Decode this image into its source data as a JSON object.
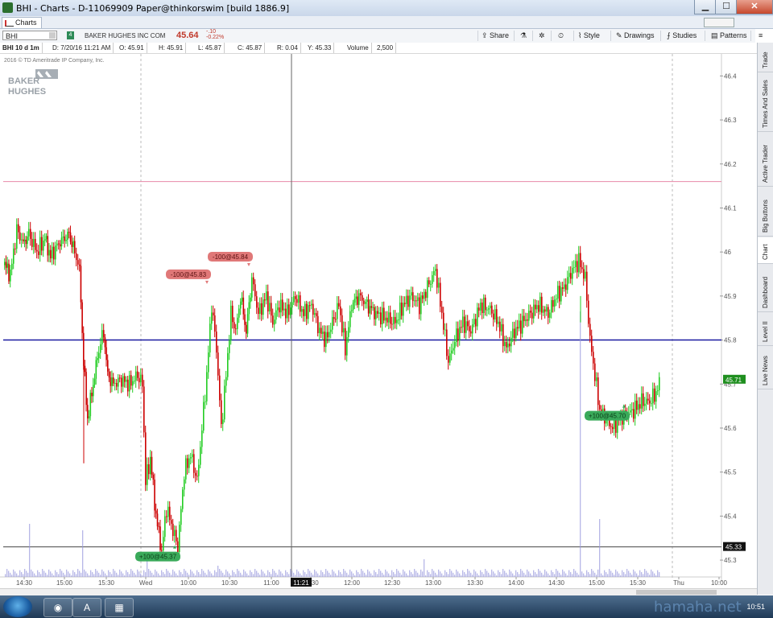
{
  "window": {
    "title": "BHI - Charts - D-11069909 Paper@thinkorswim [build 1886.9]",
    "tab_label": "Charts",
    "controls": {
      "minimize": "▁",
      "maximize": "☐",
      "close": "✕"
    }
  },
  "toolbar": {
    "symbol": "BHI",
    "company": "BAKER HUGHES INC COM",
    "last_price": "45.64",
    "change": "-.10",
    "change_pct": "-0.22%",
    "buttons": {
      "share": "Share",
      "style": "Style",
      "drawings": "Drawings",
      "studies": "Studies",
      "patterns": "Patterns"
    }
  },
  "infobar": {
    "symbol_period": "BHI 10 d 1m",
    "date": "D: 7/20/16 11:21 AM",
    "open": "O: 45.91",
    "high": "H: 45.91",
    "low": "L: 45.87",
    "close": "C: 45.87",
    "range": "R: 0.04",
    "y": "Y: 45.33",
    "volume_label": "Volume",
    "volume": "2,500"
  },
  "copyright": "2016 © TD Ameritrade IP Company, Inc.",
  "logo": {
    "line1": "BAKER",
    "line2": "HUGHES"
  },
  "sidebar_tabs": [
    "Trade",
    "Times And Sales",
    "Active Trader",
    "Big Buttons",
    "Chart",
    "Dashboard",
    "Level II",
    "Live News"
  ],
  "sidebar_active": "Chart",
  "colors": {
    "up": "#22cc22",
    "down": "#cc0000",
    "pink_line": "#e88aa8",
    "blue_line": "#1a1aa0",
    "volume": "#9999dd",
    "price_tag": "#1f8f1f",
    "sell_bubble": "#e07878",
    "buy_bubble": "#3aaa5a"
  },
  "taskbar": {
    "time": "10:51"
  },
  "watermark": "hamaha.net",
  "chart_data": {
    "type": "candlestick",
    "y_ticks": [
      "46.4",
      "46.3",
      "46.2",
      "46.1",
      "46",
      "45.9",
      "45.8",
      "45.7",
      "45.6",
      "45.5",
      "45.4",
      "45.3"
    ],
    "ylim": [
      45.28,
      46.45
    ],
    "x_ticks": [
      "14:30",
      "15:00",
      "15:30",
      "Wed",
      "10:00",
      "10:30",
      "11:00",
      "11:30",
      "12:00",
      "12:30",
      "13:00",
      "13:30",
      "14:00",
      "14:30",
      "15:00",
      "15:30",
      "Thu",
      "10:00"
    ],
    "crosshair_time": "11:21",
    "current_price_tag": "45.71",
    "crosshair_price_tag": "45.33",
    "horizontal_lines": [
      {
        "price": 46.16,
        "color": "pink"
      },
      {
        "price": 45.8,
        "color": "blue"
      },
      {
        "price": 45.33,
        "color": "gray"
      }
    ],
    "trades": [
      {
        "label": "-100@45.83",
        "side": "sell",
        "x_index": 260,
        "price": 45.92
      },
      {
        "label": "-100@45.84",
        "side": "sell",
        "x_index": 312,
        "price": 45.96
      },
      {
        "label": "+100@45.37",
        "side": "buy",
        "x_index": 220,
        "price": 45.33
      },
      {
        "label": "+100@45.70",
        "side": "buy",
        "x_index": 778,
        "price": 45.65
      }
    ],
    "price_path": [
      [
        5,
        45.97
      ],
      [
        12,
        45.95
      ],
      [
        20,
        46.05
      ],
      [
        28,
        46.02
      ],
      [
        35,
        46.04
      ],
      [
        45,
        46.0
      ],
      [
        55,
        46.03
      ],
      [
        62,
        45.99
      ],
      [
        72,
        46.02
      ],
      [
        85,
        46.04
      ],
      [
        92,
        46.0
      ],
      [
        98,
        45.96
      ],
      [
        103,
        45.75
      ],
      [
        108,
        45.62
      ],
      [
        115,
        45.7
      ],
      [
        122,
        45.78
      ],
      [
        128,
        45.82
      ],
      [
        133,
        45.72
      ],
      [
        140,
        45.7
      ],
      [
        150,
        45.71
      ],
      [
        160,
        45.7
      ],
      [
        170,
        45.72
      ],
      [
        176,
        45.7
      ],
      [
        180,
        45.48
      ],
      [
        186,
        45.53
      ],
      [
        193,
        45.4
      ],
      [
        200,
        45.32
      ],
      [
        206,
        45.42
      ],
      [
        212,
        45.38
      ],
      [
        220,
        45.33
      ],
      [
        228,
        45.5
      ],
      [
        236,
        45.54
      ],
      [
        244,
        45.48
      ],
      [
        250,
        45.6
      ],
      [
        256,
        45.72
      ],
      [
        262,
        45.88
      ],
      [
        268,
        45.78
      ],
      [
        274,
        45.6
      ],
      [
        280,
        45.72
      ],
      [
        286,
        45.86
      ],
      [
        292,
        45.82
      ],
      [
        298,
        45.9
      ],
      [
        305,
        45.82
      ],
      [
        312,
        45.94
      ],
      [
        320,
        45.86
      ],
      [
        330,
        45.9
      ],
      [
        338,
        45.84
      ],
      [
        346,
        45.88
      ],
      [
        356,
        45.86
      ],
      [
        366,
        45.9
      ],
      [
        376,
        45.86
      ],
      [
        386,
        45.88
      ],
      [
        396,
        45.82
      ],
      [
        404,
        45.8
      ],
      [
        412,
        45.84
      ],
      [
        420,
        45.88
      ],
      [
        428,
        45.78
      ],
      [
        436,
        45.88
      ],
      [
        445,
        45.9
      ],
      [
        455,
        45.88
      ],
      [
        466,
        45.86
      ],
      [
        478,
        45.85
      ],
      [
        490,
        45.84
      ],
      [
        500,
        45.88
      ],
      [
        510,
        45.9
      ],
      [
        520,
        45.88
      ],
      [
        530,
        45.92
      ],
      [
        540,
        45.96
      ],
      [
        548,
        45.86
      ],
      [
        556,
        45.75
      ],
      [
        564,
        45.8
      ],
      [
        574,
        45.84
      ],
      [
        584,
        45.82
      ],
      [
        596,
        45.88
      ],
      [
        608,
        45.87
      ],
      [
        618,
        45.84
      ],
      [
        628,
        45.78
      ],
      [
        638,
        45.82
      ],
      [
        648,
        45.84
      ],
      [
        658,
        45.86
      ],
      [
        668,
        45.88
      ],
      [
        680,
        45.86
      ],
      [
        690,
        45.9
      ],
      [
        700,
        45.92
      ],
      [
        710,
        45.96
      ],
      [
        718,
        45.98
      ],
      [
        726,
        45.94
      ],
      [
        732,
        45.8
      ],
      [
        738,
        45.72
      ],
      [
        744,
        45.64
      ],
      [
        752,
        45.62
      ],
      [
        760,
        45.6
      ],
      [
        768,
        45.62
      ],
      [
        776,
        45.63
      ],
      [
        786,
        45.64
      ],
      [
        796,
        45.66
      ],
      [
        806,
        45.66
      ],
      [
        814,
        45.68
      ],
      [
        820,
        45.71
      ]
    ]
  }
}
